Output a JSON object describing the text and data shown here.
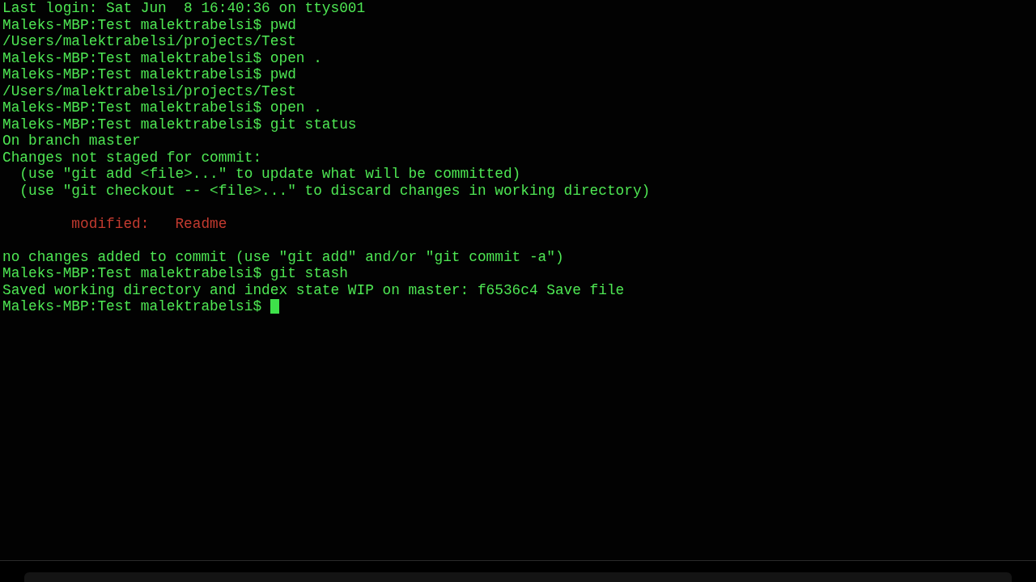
{
  "terminal": {
    "lines": [
      {
        "kind": "output",
        "text": "Last login: Sat Jun  8 16:40:36 on ttys001"
      },
      {
        "kind": "prompt",
        "text": "Maleks-MBP:Test malektrabelsi$ pwd"
      },
      {
        "kind": "output",
        "text": "/Users/malektrabelsi/projects/Test"
      },
      {
        "kind": "prompt",
        "text": "Maleks-MBP:Test malektrabelsi$ open ."
      },
      {
        "kind": "prompt",
        "text": "Maleks-MBP:Test malektrabelsi$ pwd"
      },
      {
        "kind": "output",
        "text": "/Users/malektrabelsi/projects/Test"
      },
      {
        "kind": "prompt",
        "text": "Maleks-MBP:Test malektrabelsi$ open ."
      },
      {
        "kind": "prompt",
        "text": "Maleks-MBP:Test malektrabelsi$ git status"
      },
      {
        "kind": "output",
        "text": "On branch master"
      },
      {
        "kind": "output",
        "text": "Changes not staged for commit:"
      },
      {
        "kind": "output",
        "text": "  (use \"git add <file>...\" to update what will be committed)"
      },
      {
        "kind": "output",
        "text": "  (use \"git checkout -- <file>...\" to discard changes in working directory)"
      },
      {
        "kind": "blank"
      },
      {
        "kind": "modified",
        "text": "        modified:   Readme"
      },
      {
        "kind": "blank"
      },
      {
        "kind": "output",
        "text": "no changes added to commit (use \"git add\" and/or \"git commit -a\")"
      },
      {
        "kind": "prompt",
        "text": "Maleks-MBP:Test malektrabelsi$ git stash"
      },
      {
        "kind": "output",
        "text": "Saved working directory and index state WIP on master: f6536c4 Save file"
      },
      {
        "kind": "prompt",
        "text": "Maleks-MBP:Test malektrabelsi$ ",
        "cursor": true
      }
    ]
  }
}
